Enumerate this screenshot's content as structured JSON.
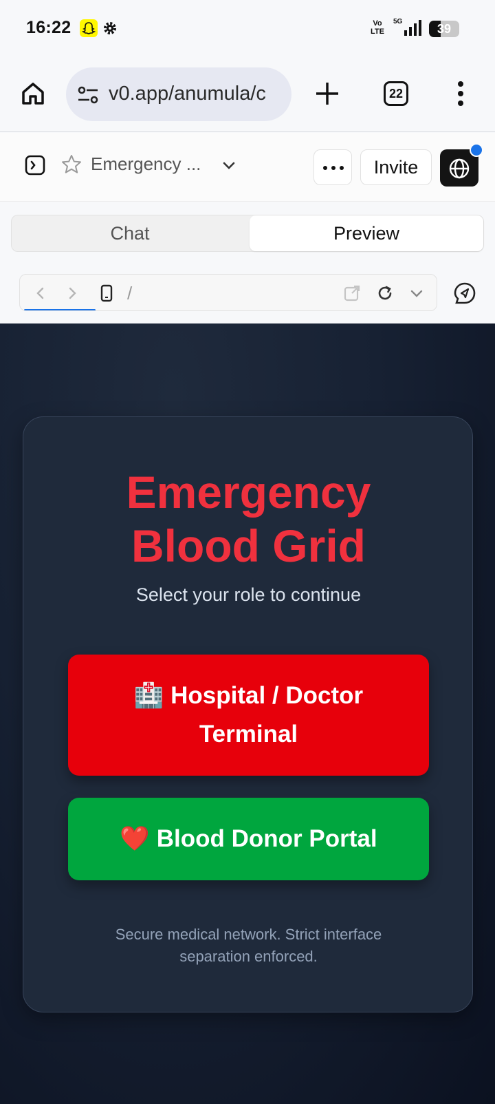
{
  "status_bar": {
    "time": "16:22",
    "volte": "Vo LTE",
    "network": "5G",
    "battery": "39",
    "battery_fraction": 0.39,
    "icons": [
      "snapchat-icon",
      "settings-icon",
      "signal-icon",
      "battery-icon"
    ]
  },
  "browser": {
    "url": "v0.app/anumula/c",
    "tab_count": "22",
    "icons": [
      "home-icon",
      "tune-icon",
      "plus-icon",
      "more-vert-icon"
    ]
  },
  "v0_header": {
    "project_name": "Emergency ...",
    "invite_label": "Invite",
    "icons": [
      "sidebar-toggle-icon",
      "star-icon",
      "chevron-down-icon",
      "more-horiz-icon",
      "globe-icon"
    ]
  },
  "tabs": [
    {
      "label": "Chat",
      "active": false
    },
    {
      "label": "Preview",
      "active": true
    }
  ],
  "preview_bar": {
    "path": "/",
    "icons": [
      "back-icon",
      "forward-icon",
      "device-icon",
      "open-external-icon",
      "reload-icon",
      "chevron-down-icon",
      "feedback-icon"
    ]
  },
  "app": {
    "title_line1": "Emergency",
    "title_line2": "Blood Grid",
    "subtitle": "Select your role to continue",
    "hospital_button": {
      "emoji": "🏥",
      "line1": "Hospital / Doctor",
      "line2": "Terminal"
    },
    "donor_button": {
      "emoji": "❤️",
      "label": "Blood Donor Portal"
    },
    "footer": "Secure medical network. Strict interface separation enforced.",
    "colors": {
      "title": "#f0313e",
      "hospital": "#e7000b",
      "donor": "#00a63e",
      "card": "#1f2a3b"
    }
  }
}
